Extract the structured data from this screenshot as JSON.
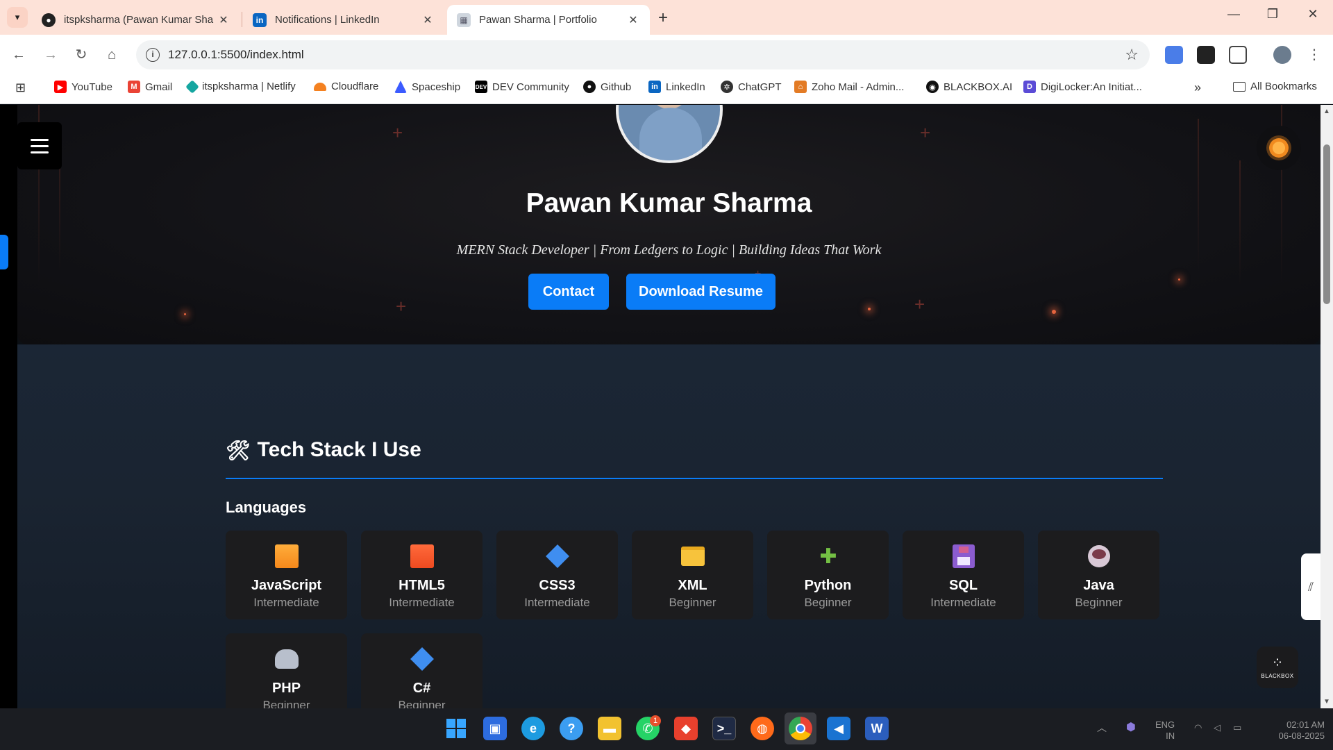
{
  "browser": {
    "tabs": [
      {
        "title": "itspksharma (Pawan Kumar Sha",
        "icon": "github-icon"
      },
      {
        "title": "Notifications | LinkedIn",
        "icon": "linkedin-icon"
      },
      {
        "title": "Pawan Sharma | Portfolio",
        "icon": "portfolio-icon",
        "active": true
      }
    ],
    "url": "127.0.0.1:5500/index.html",
    "bookmarks": [
      {
        "label": "YouTube",
        "icon": "youtube-icon",
        "color": "#ff0000"
      },
      {
        "label": "Gmail",
        "icon": "gmail-icon",
        "color": "#ea4335"
      },
      {
        "label": "itspksharma | Netlify",
        "icon": "netlify-icon",
        "color": "#15a6a0"
      },
      {
        "label": "Cloudflare",
        "icon": "cloudflare-icon",
        "color": "#f48120"
      },
      {
        "label": "Spaceship",
        "icon": "spaceship-icon",
        "color": "#3b5bff"
      },
      {
        "label": "DEV Community",
        "icon": "dev-icon",
        "color": "#000000"
      },
      {
        "label": "Github",
        "icon": "github-icon",
        "color": "#000000"
      },
      {
        "label": "LinkedIn",
        "icon": "linkedin-icon",
        "color": "#0a66c2"
      },
      {
        "label": "ChatGPT",
        "icon": "chatgpt-icon",
        "color": "#333333"
      },
      {
        "label": "Zoho Mail - Admin...",
        "icon": "zoho-icon",
        "color": "#e37b25"
      },
      {
        "label": "BLACKBOX.AI",
        "icon": "blackbox-icon",
        "color": "#111111"
      },
      {
        "label": "DigiLocker:An Initiat...",
        "icon": "digilocker-icon",
        "color": "#5b4bd6"
      }
    ],
    "all_bookmarks": "All Bookmarks",
    "more_bookmarks": "»"
  },
  "hero": {
    "name": "Pawan Kumar Sharma",
    "tagline": "MERN Stack Developer | From Ledgers to Logic | Building Ideas That Work",
    "contact_label": "Contact",
    "resume_label": "Download Resume"
  },
  "tech": {
    "title": "Tech Stack I Use",
    "subtitle": "Languages",
    "items": [
      {
        "name": "JavaScript",
        "level": "Intermediate",
        "icon": "orange-square-icon"
      },
      {
        "name": "HTML5",
        "level": "Intermediate",
        "icon": "red-square-icon"
      },
      {
        "name": "CSS3",
        "level": "Intermediate",
        "icon": "blue-diamond-icon"
      },
      {
        "name": "XML",
        "level": "Beginner",
        "icon": "folder-icon"
      },
      {
        "name": "Python",
        "level": "Beginner",
        "icon": "puzzle-icon"
      },
      {
        "name": "SQL",
        "level": "Intermediate",
        "icon": "floppy-disk-icon"
      },
      {
        "name": "Java",
        "level": "Beginner",
        "icon": "coffee-icon"
      },
      {
        "name": "PHP",
        "level": "Beginner",
        "icon": "elephant-icon"
      },
      {
        "name": "C#",
        "level": "Beginner",
        "icon": "blue-diamond-icon"
      }
    ]
  },
  "widgets": {
    "blackbox_label": "BLACKBOX"
  },
  "taskbar": {
    "lang_top": "ENG",
    "lang_bottom": "IN",
    "time": "02:01 AM",
    "date": "06-08-2025",
    "whatsapp_badge": "1"
  }
}
